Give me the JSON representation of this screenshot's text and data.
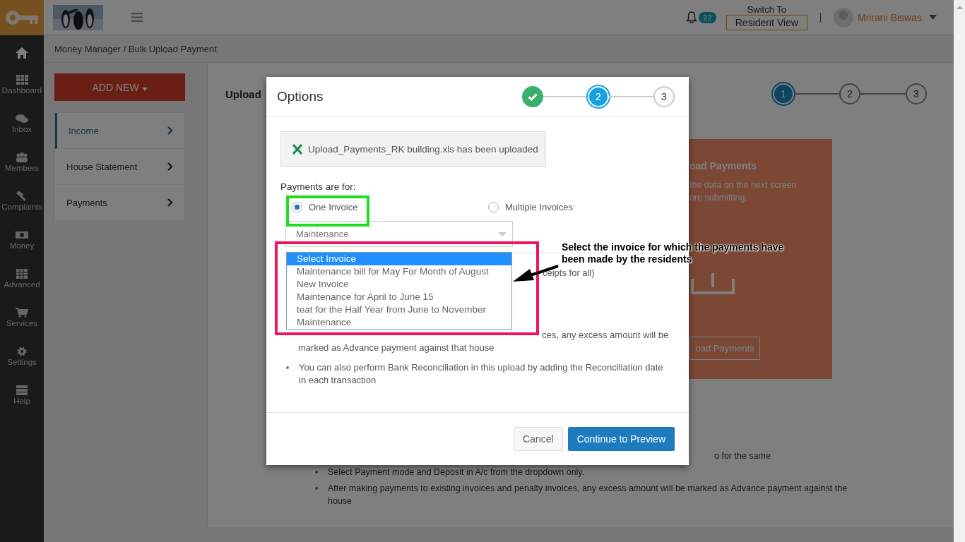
{
  "sidebar": {
    "items": [
      {
        "label": "Dashboard"
      },
      {
        "label": "Inbox"
      },
      {
        "label": "Members"
      },
      {
        "label": "Complaints"
      },
      {
        "label": "Money"
      },
      {
        "label": "Advanced"
      },
      {
        "label": "Services"
      },
      {
        "label": "Settings"
      },
      {
        "label": "Help"
      }
    ]
  },
  "topbar": {
    "notification_count": "22",
    "switch_label": "Switch To",
    "switch_button": "Resident View",
    "user_name": "Mrirani Biswas"
  },
  "breadcrumb": "Money Manager / Bulk Upload Payment",
  "add_new_button": "ADD NEW",
  "menu": [
    {
      "label": "Income",
      "selected": true
    },
    {
      "label": "House Statement",
      "selected": false
    },
    {
      "label": "Payments",
      "selected": false
    }
  ],
  "main": {
    "title": "Upload",
    "steps": [
      {
        "label": "1",
        "selected": true
      },
      {
        "label": "2",
        "selected": false
      },
      {
        "label": "3",
        "selected": false
      }
    ],
    "card": {
      "title": "oad Payments",
      "lines": [
        "the data on the next screen",
        "ore submitting."
      ],
      "button": "oad Payments"
    },
    "notes": [
      {
        "kind": "line",
        "text": "o for the same"
      },
      {
        "kind": "bullet",
        "text": "Select Payment mode and Deposit in A/c from the dropdown only."
      },
      {
        "kind": "bullet",
        "text": "After making payments to existing invoices and penalty invoices, any excess amount will be marked as Advance payment against the house"
      }
    ]
  },
  "modal": {
    "title": "Options",
    "steps": [
      {
        "done": true
      },
      {
        "label": "2",
        "done": false,
        "selected": true
      },
      {
        "label": "3",
        "done": false,
        "selected": false
      }
    ],
    "upload_message": "Upload_Payments_RK building.xls has been uploaded",
    "payments_label": "Payments are for:",
    "options": [
      {
        "label": "One Invoice",
        "selected": true
      },
      {
        "label": "Multiple Invoices",
        "selected": false
      }
    ],
    "select_value": "Maintenance",
    "dropdown": [
      {
        "label": "Select Invoice",
        "selected": true
      },
      {
        "label": "Maintenance bill for May For Month of August",
        "selected": false
      },
      {
        "label": "New Invoice",
        "selected": false
      },
      {
        "label": "Maintenance for April to June 15",
        "selected": false
      },
      {
        "label": "teat for the Half Year from June to November",
        "selected": false
      },
      {
        "label": "Maintenance",
        "selected": false
      }
    ],
    "receipts_fragment": "ceipts for all)",
    "notes": [
      {
        "kind": "fragment",
        "lines": [
          "ces, any excess amount will be",
          "marked as Advance payment against that house"
        ]
      },
      {
        "kind": "bullet",
        "text": "You can also perform Bank Reconciliation in this upload by adding the Reconciliation date in each transaction"
      }
    ],
    "buttons": [
      {
        "label": "Cancel",
        "kind": "secondary"
      },
      {
        "label": "Continue to Preview",
        "kind": "primary"
      }
    ]
  },
  "annotation": {
    "text": "Select the invoice for which the payments have been made by the residents"
  }
}
